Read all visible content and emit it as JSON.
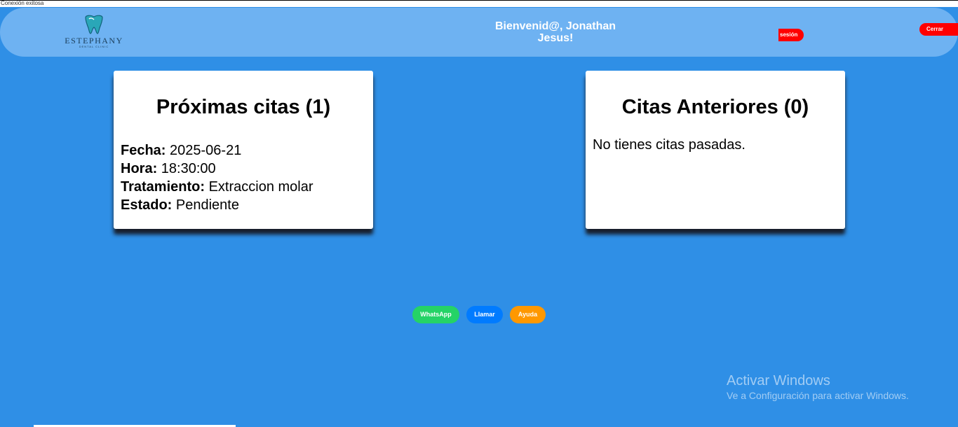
{
  "status": "Conexión exitosa",
  "header": {
    "logo_name": "ESTEPHANY",
    "logo_sub": "DENTAL CLINIC",
    "welcome": "Bienvenid@, Jonathan Jesus!",
    "logout_label": "sesión",
    "close_label": "Cerrar"
  },
  "upcoming": {
    "title": "Próximas citas (1)",
    "items": [
      {
        "fecha_label": "Fecha:",
        "fecha": "2025-06-21",
        "hora_label": "Hora:",
        "hora": "18:30:00",
        "tratamiento_label": "Tratamiento:",
        "tratamiento": "Extraccion molar",
        "estado_label": "Estado:",
        "estado": "Pendiente"
      }
    ]
  },
  "past": {
    "title": "Citas Anteriores (0)",
    "empty_message": "No tienes citas pasadas."
  },
  "contact": {
    "whatsapp": "WhatsApp",
    "call": "Llamar",
    "help": "Ayuda"
  },
  "watermark": {
    "title": "Activar Windows",
    "subtitle": "Ve a Configuración para activar Windows."
  },
  "colors": {
    "background": "#2f8fe6",
    "header": "#6eb2f2",
    "danger": "#ff0000",
    "whatsapp": "#25d366",
    "call": "#007bff",
    "help": "#ff9800"
  }
}
